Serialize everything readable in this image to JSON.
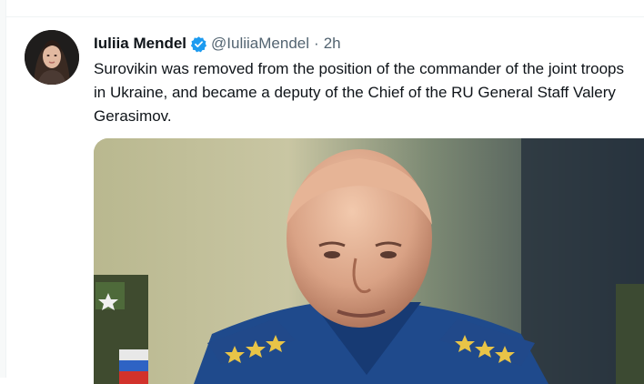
{
  "tweet": {
    "author_name": "Iuliia Mendel",
    "handle": "@IuliiaMendel",
    "separator": "·",
    "time": "2h",
    "verified": true,
    "verified_color": "#1d9bf0",
    "text": "Surovikin was removed from the position of the commander of the joint troops in Ukraine, and became a deputy of the Chief of the RU General Staff Valery Gerasimov.",
    "media": {
      "type": "photo",
      "subject": "bald man in blue uniform with gold shoulder-board stars"
    }
  },
  "icons": {
    "verified": "verified-badge-icon",
    "avatar": "author-avatar"
  }
}
